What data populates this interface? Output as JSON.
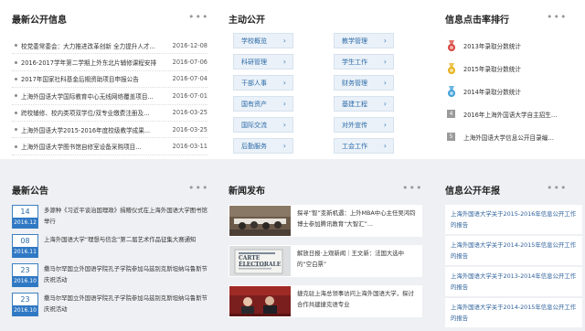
{
  "info_public": {
    "title": "最新公开信息",
    "items": [
      {
        "text": "校党委常委会：大力推进改革创新 全力提升人才...",
        "date": "2016-12-08"
      },
      {
        "text": "2016-2017学年第二学期上外东北片辅修课程安排",
        "date": "2016-07-06"
      },
      {
        "text": "2017年国家社科基金后期资助项目申报公告",
        "date": "2016-07-04"
      },
      {
        "text": "上海外国语大学国际教育中心无线网络覆盖项目...",
        "date": "2016-07-01"
      },
      {
        "text": "跨校辅修、校内类项双学位/双专业缴费注册及...",
        "date": "2016-03-25"
      },
      {
        "text": "上海外国语大学2015-2016年度校级教学成果...",
        "date": "2016-03-25"
      },
      {
        "text": "上海外国语大学图书馆自修室设备采购项目...",
        "date": "2016-03-11"
      }
    ]
  },
  "main_public": {
    "title": "主动公开",
    "left": [
      "学校概览",
      "科研管理",
      "干部人事",
      "国有资产",
      "国际交流",
      "后勤服务"
    ],
    "right": [
      "教学管理",
      "学生工作",
      "财务管理",
      "基建工程",
      "对外宣传",
      "工会工作"
    ],
    "chevron": "›"
  },
  "ranking": {
    "title": "信息点击率排行",
    "items": [
      {
        "icon": "red-medal-icon",
        "text": "2013年录取分数统计"
      },
      {
        "icon": "gold-medal-icon",
        "text": "2015年录取分数统计"
      },
      {
        "icon": "blue-medal-icon",
        "text": "2014年录取分数统计"
      },
      {
        "icon": "number-4-icon",
        "num": "4",
        "text": "2016年上海外国语大学自主招生简..."
      },
      {
        "icon": "number-5-icon",
        "num": "5",
        "text": "上海外国语大学信息公开目录编制..."
      }
    ]
  },
  "announcements": {
    "title": "最新公告",
    "items": [
      {
        "day": "14",
        "ym": "2016.12",
        "text": "多源种《习近平谈治国理政》捐赠仪式在上海外国语大学图书馆举行"
      },
      {
        "day": "08",
        "ym": "2016.11",
        "text": "上海外国语大学“理想与信念”第二届艺术作品征集大赛通知"
      },
      {
        "day": "23",
        "ym": "2016.10",
        "text": "撒马尔罕国立外国语学院孔子学院参加乌兹别克斯坦纳乌鲁斯节庆祝活动"
      },
      {
        "day": "23",
        "ym": "2016.10",
        "text": "撒马尔罕国立外国语学院孔子学院参加乌兹别克斯坦纳乌鲁斯节庆祝活动"
      }
    ]
  },
  "news": {
    "title": "新闻发布",
    "items": [
      {
        "text": "探寻“智”变新机遇：上外MBA中心主任吴鸿钧博士参加腾讯教育“大智汇”..."
      },
      {
        "text": "解放日报·上观新闻｜王文新：法国大选中的“空白票”",
        "thumb_caption": "CARTE ÉLECTORALE"
      },
      {
        "text": "捷克驻上海总领事访问上海外国语大学，探讨合作共建捷克语专业"
      }
    ]
  },
  "annual_report": {
    "title": "信息公开年报",
    "items": [
      "上海外国语大学关于2015-2016年信息公开工作的报告",
      "上海外国语大学关于2014-2015年信息公开工作的报告",
      "上海外国语大学关于2013-2014年信息公开工作的报告",
      "上海外国语大学关于2014-2015年信息公开工作的报告"
    ]
  },
  "more_label": "•••",
  "colors": {
    "accent": "#2f78c4",
    "link": "#2b6aa8",
    "medal_red": "#d8433a",
    "medal_gold": "#e7b21a",
    "medal_blue": "#3f9fd8"
  }
}
